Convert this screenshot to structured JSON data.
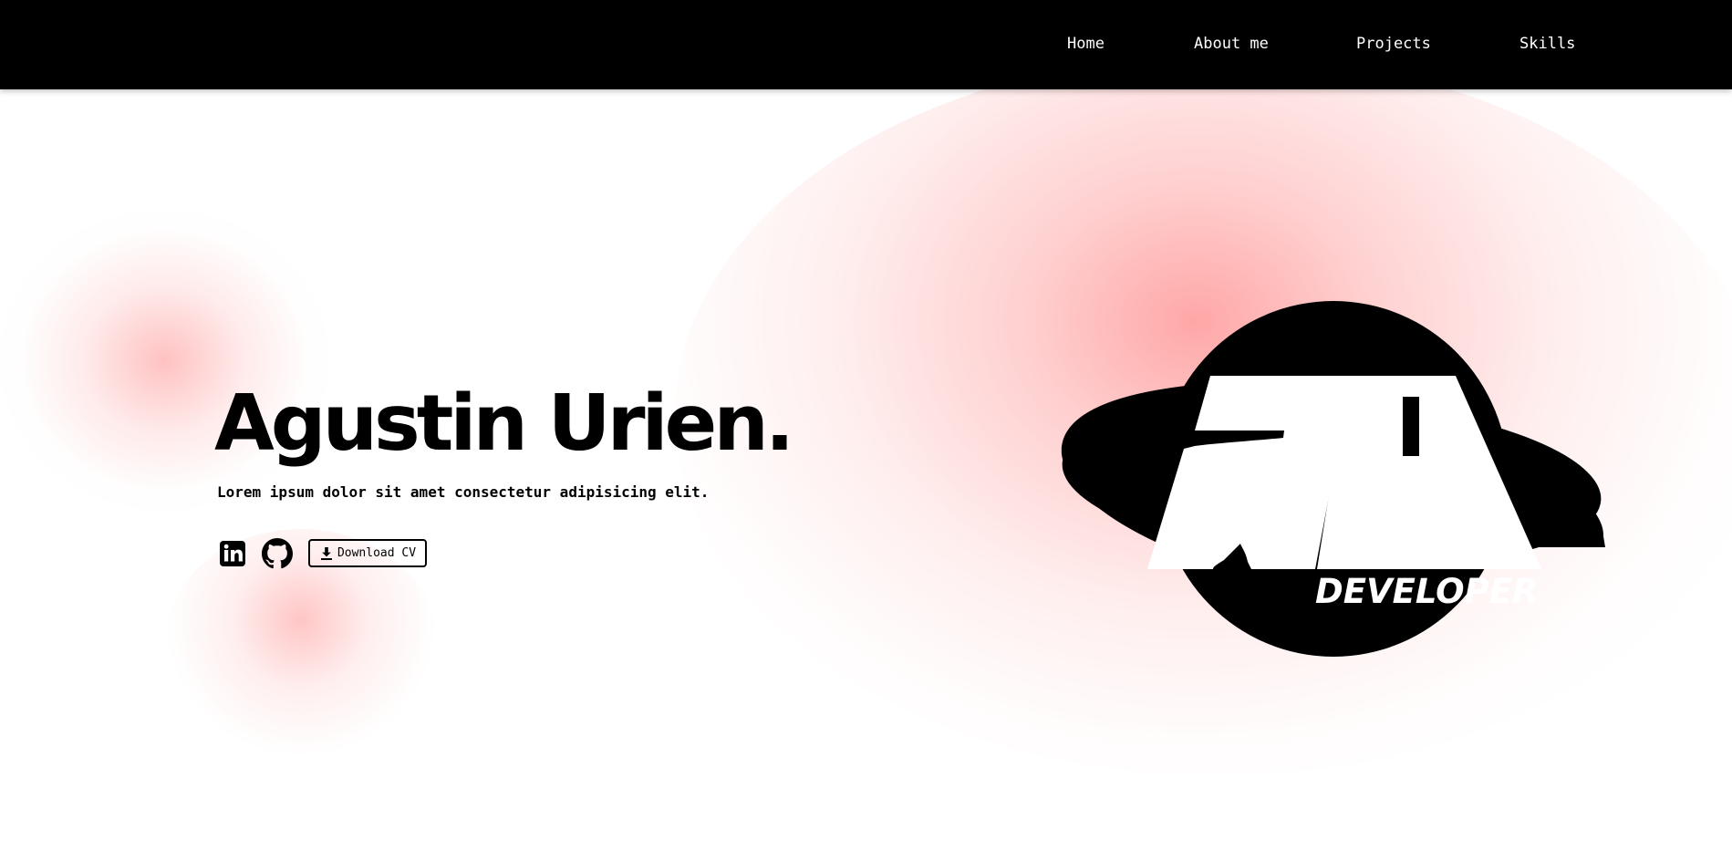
{
  "nav": {
    "items": [
      {
        "label": "Home"
      },
      {
        "label": "About me"
      },
      {
        "label": "Projects"
      },
      {
        "label": "Skills"
      }
    ]
  },
  "hero": {
    "name": "Agustin Urien.",
    "tagline": "Lorem ipsum dolor sit amet consectetur adipisicing elit.",
    "social": {
      "linkedin_icon": "linkedin-icon",
      "github_icon": "github-icon"
    },
    "cv_button": {
      "icon": "download-icon",
      "label": "Download CV"
    }
  },
  "logo": {
    "caption": "DEVELOPER",
    "icon": "au-planet-logo"
  },
  "colors": {
    "navbar_bg": "#000000",
    "nav_text": "#ffffff",
    "text": "#000000",
    "glow": "#ffa3a3",
    "background": "#ffffff"
  }
}
